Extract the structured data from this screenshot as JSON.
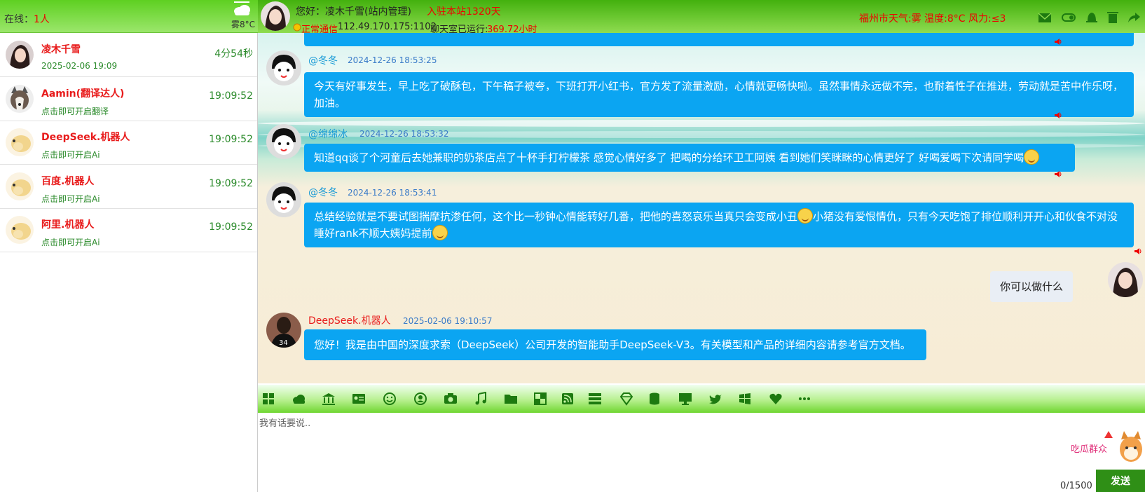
{
  "sidebar": {
    "online_label": "在线：",
    "online_count": "1人",
    "weather": "雾8°C",
    "contacts": [
      {
        "name": "凌木千雪",
        "sub": "2025-02-06 19:09",
        "time": "4分54秒",
        "avatar": "girl-avatar"
      },
      {
        "name": "Aamin(翻译达人)",
        "sub": "点击即可开启翻译",
        "time": "19:09:52",
        "avatar": "husky-avatar"
      },
      {
        "name": "DeepSeek.机器人",
        "sub": "点击即可开启Ai",
        "time": "19:09:52",
        "avatar": "pig-avatar"
      },
      {
        "name": "百度.机器人",
        "sub": "点击即可开启Ai",
        "time": "19:09:52",
        "avatar": "pig-avatar"
      },
      {
        "name": "阿里.机器人",
        "sub": "点击即可开启Ai",
        "time": "19:09:52",
        "avatar": "pig-avatar"
      }
    ]
  },
  "header": {
    "greeting": "您好：凌木千雪(站内管理)",
    "days": "入驻本站1320天",
    "status": "正常通信",
    "ip": "112.49.170.175:1102",
    "run_label": "聊天室已运行:",
    "run_value": "369.72小时",
    "weather": "福州市天气:雾 温度:8°C 风力:≤3",
    "icons": [
      "mail-icon",
      "toggle-icon",
      "bell-icon",
      "trash-icon",
      "share-icon"
    ]
  },
  "messages": [
    {
      "name": "@冬冬",
      "time": "2024-12-26 18:53:25",
      "text": "今天有好事发生，早上吃了破酥包，下午稿子被夸，下班打开小红书，官方发了流量激励，心情就更畅快啦。虽然事情永远做不完，也耐着性子在推进，劳动就是苦中作乐呀，加油。"
    },
    {
      "name": "@绵绵冰",
      "time": "2024-12-26 18:53:32",
      "text": "知道qq谈了个河童后去她兼职的奶茶店点了十杯手打柠檬茶 感觉心情好多了 把喝的分给环卫工阿姨 看到她们笑眯眯的心情更好了 好喝爱喝下次请同学喝"
    },
    {
      "name": "@冬冬",
      "time": "2024-12-26 18:53:41",
      "text_a": "总结经验就是不要试图揣摩抗渗任何，这个比一秒钟心情能转好几番，把他的喜怒哀乐当真只会变成小丑",
      "text_b": "小猪没有爱恨情仇，只有今天吃饱了排位顺利开开心和伙食不对没睡好rank不顺大姨妈提前"
    },
    {
      "text": "你可以做什么"
    },
    {
      "name": "DeepSeek.机器人",
      "time": "2025-02-06 19:10:57",
      "text": "您好！我是由中国的深度求索（DeepSeek）公司开发的智能助手DeepSeek-V3。有关模型和产品的详细内容请参考官方文档。"
    }
  ],
  "toolbar": {
    "icons": [
      "grid-icon",
      "cloud-icon",
      "bank-icon",
      "id-card-icon",
      "smile-icon",
      "user-circle-icon",
      "camera-icon",
      "music-icon",
      "folder-icon",
      "square-icon",
      "rss-icon",
      "server-icon",
      "diamond-icon",
      "database-icon",
      "monitor-icon",
      "twitter-icon",
      "windows-icon",
      "heart-icon",
      "more-icon"
    ]
  },
  "input": {
    "placeholder": "我有话要说..",
    "counter": "0/1500",
    "send_label": "发送",
    "mascot_text": "吃瓜群众"
  },
  "colors": {
    "accent_green": "#2f8f16",
    "bubble_blue": "#0ba5f2",
    "name_red": "#e81b1b",
    "sub_green": "#2a8a2a"
  }
}
